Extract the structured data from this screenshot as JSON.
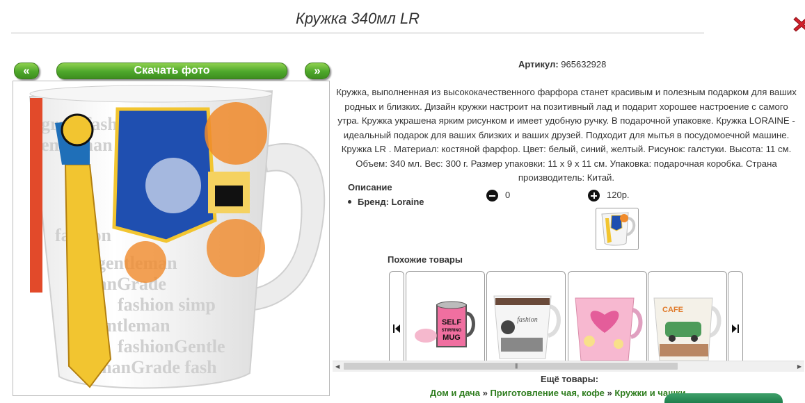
{
  "header": {
    "title": "Кружка 340мл LR",
    "close_icon": "close-x-icon"
  },
  "gallery": {
    "prev_label": "«",
    "download_label": "Скачать фото",
    "next_label": "»"
  },
  "product": {
    "sku_label": "Артикул:",
    "sku_value": "965632928",
    "description": "Кружка, выполненная из высококачественного фарфора станет красивым и полезным подарком для ваших родных и близких. Дизайн кружки настроит на позитивный лад и подарит хорошее настроение с самого утра. Кружка украшена ярким рисунком и имеет удобную ручку. В подарочной упаковке. Кружка LORAINE - идеальный подарок для ваших близких и ваших друзей. Подходит для мытья в посудомоечной машине. Кружка LR . Материал: костяной фарфор. Цвет: белый, синий, желтый. Рисунок: галстуки. Высота: 11 см. Объем: 340 мл. Вес: 300 г. Размер упаковки: 11 x 9 x 11 см. Упаковка: подарочная коробка. Страна производитель: Китай.",
    "desc_heading": "Описание",
    "brand": "Бренд: Loraine",
    "quantity": "0",
    "price": "120р."
  },
  "similar": {
    "title": "Похожие товары",
    "items": [
      {
        "name": "self-stirring-mug",
        "text": "SELF STIRRING MUG"
      },
      {
        "name": "fashion-mug",
        "text": "fashion"
      },
      {
        "name": "heart-mug",
        "text": ""
      },
      {
        "name": "car-mug",
        "text": "CAFE"
      }
    ]
  },
  "more": {
    "title": "Ещё товары:"
  },
  "breadcrumb": {
    "items": [
      "Дом и дача",
      "Приготовление чая, кофе",
      "Кружки и чашки"
    ],
    "separator": "»"
  },
  "colors": {
    "accent_green": "#4ea72b",
    "link_green": "#2e7d1e",
    "close_red": "#d0202a"
  }
}
